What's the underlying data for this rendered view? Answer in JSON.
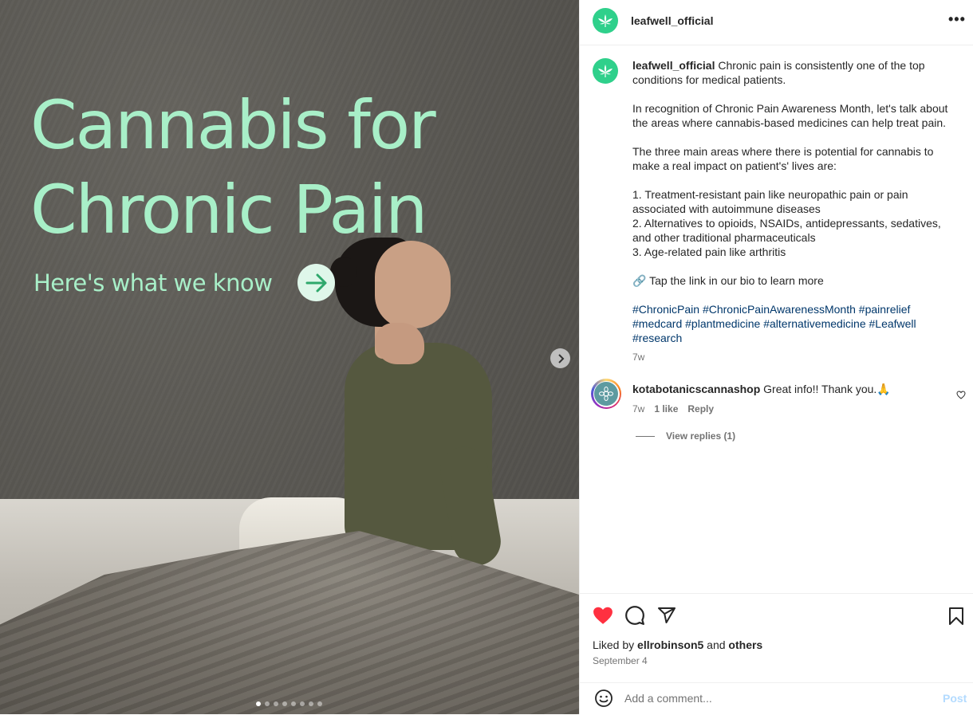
{
  "media": {
    "headline_line1": "Cannabis for",
    "headline_line2": "Chronic Pain",
    "subheadline": "Here's what we know",
    "carousel_dots": 8,
    "active_dot": 0
  },
  "header": {
    "username": "leafwell_official",
    "more_label": "•••"
  },
  "caption": {
    "username": "leafwell_official",
    "intro": "Chronic pain is consistently one of the top conditions for medical patients.",
    "p2": "In recognition of Chronic Pain Awareness Month, let's talk about the areas where cannabis-based medicines can help treat pain.",
    "p3": "The three main areas where there is potential for cannabis to make a real impact on patient's' lives are:",
    "list1": "1. Treatment-resistant pain like neuropathic pain or pain associated with autoimmune diseases",
    "list2": "2. Alternatives to opioids, NSAIDs, antidepressants, sedatives, and other traditional pharmaceuticals",
    "list3": "3. Age-related pain like arthritis",
    "link_text": "🔗 Tap the link in our bio to learn more",
    "hashtags": "#ChronicPain #ChronicPainAwarenessMonth #painrelief #medcard #plantmedicine #alternativemedicine #Leafwell #research",
    "time": "7w"
  },
  "comment": {
    "username": "kotabotanicscannashop",
    "text": "Great info!! Thank you.🙏",
    "time": "7w",
    "likes": "1 like",
    "reply_label": "Reply",
    "view_replies": "View replies (1)"
  },
  "actions": {
    "liked_by_prefix": "Liked by",
    "liked_by_user": "ellrobinson5",
    "liked_by_and": "and",
    "liked_by_others": "others",
    "date": "September 4"
  },
  "add_comment": {
    "placeholder": "Add a comment...",
    "post_label": "Post"
  },
  "colors": {
    "brand_green": "#2fd08b",
    "headline_mint": "#a8efc8",
    "like_red": "#ff3040",
    "hashtag_blue": "#00376b"
  }
}
